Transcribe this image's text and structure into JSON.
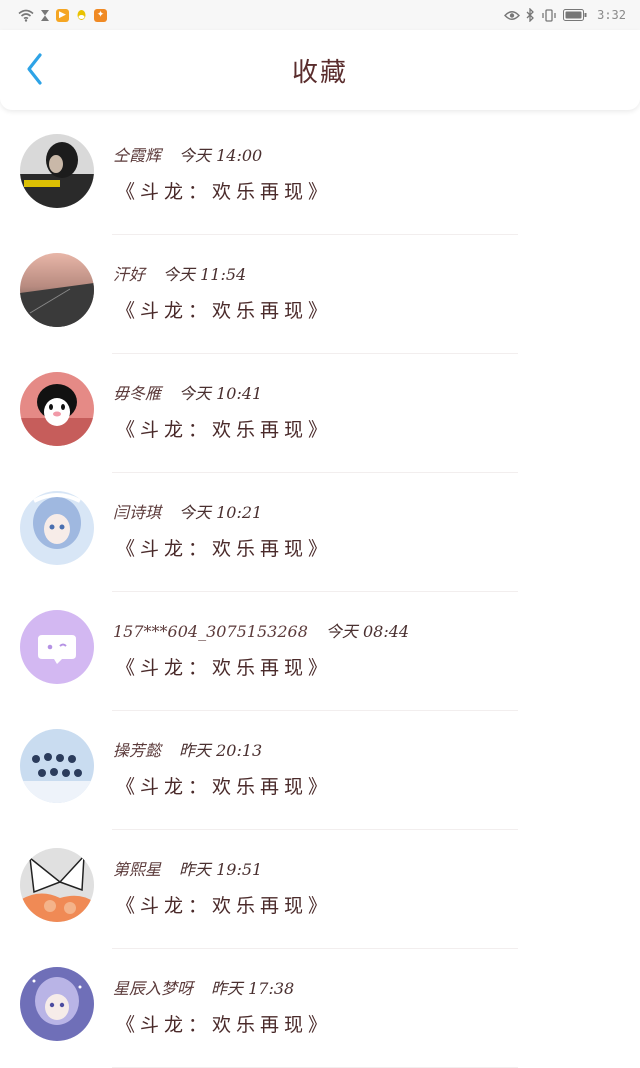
{
  "status_bar": {
    "time": "3:32",
    "left_icons": [
      "wifi-icon",
      "hourglass-icon",
      "video-app-icon",
      "qq-app-icon",
      "accessibility-app-icon"
    ],
    "right_icons": [
      "eye-icon",
      "bluetooth-icon",
      "vibrate-icon",
      "battery-icon"
    ]
  },
  "header": {
    "title": "收藏",
    "back_icon": "chevron-left-icon",
    "accent_color": "#2ea3e6"
  },
  "favorites": [
    {
      "name": "仝霞辉",
      "time": "今天 14:00",
      "work": "《斗龙：欢乐再现》"
    },
    {
      "name": "汗好",
      "time": "今天 11:54",
      "work": "《斗龙：欢乐再现》"
    },
    {
      "name": "毋冬雁",
      "time": "今天 10:41",
      "work": "《斗龙：欢乐再现》"
    },
    {
      "name": "闫诗琪",
      "time": "今天 10:21",
      "work": "《斗龙：欢乐再现》"
    },
    {
      "name": "157***604_3075153268",
      "time": "今天 08:44",
      "work": "《斗龙：欢乐再现》"
    },
    {
      "name": "操芳懿",
      "time": "昨天 20:13",
      "work": "《斗龙：欢乐再现》"
    },
    {
      "name": "第熙星",
      "time": "昨天 19:51",
      "work": "《斗龙：欢乐再现》"
    },
    {
      "name": "星辰入梦呀",
      "time": "昨天 17:38",
      "work": "《斗龙：欢乐再现》"
    }
  ]
}
